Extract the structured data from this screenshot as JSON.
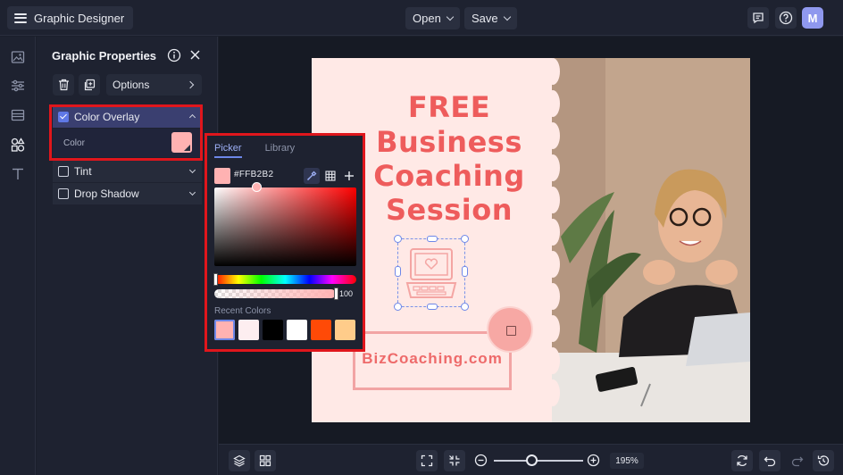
{
  "header": {
    "app_title": "Graphic Designer",
    "open_label": "Open",
    "save_label": "Save",
    "avatar_initial": "M",
    "icons": [
      "menu-icon",
      "feedback-icon",
      "help-icon"
    ]
  },
  "left_rail": {
    "icons": [
      "image-icon",
      "adjustments-icon",
      "layers-icon",
      "graphics-icon",
      "text-icon"
    ]
  },
  "properties_panel": {
    "title": "Graphic Properties",
    "options_label": "Options",
    "sections": [
      {
        "label": "Color Overlay",
        "checked": true,
        "expanded": true
      },
      {
        "label": "Tint",
        "checked": false,
        "expanded": false
      },
      {
        "label": "Drop Shadow",
        "checked": false,
        "expanded": false
      }
    ],
    "color_label": "Color",
    "color_value": "#ffb2b2"
  },
  "color_picker": {
    "tabs": [
      "Picker",
      "Library"
    ],
    "active_tab": "Picker",
    "hex": "#FFB2B2",
    "opacity": "100",
    "recent_label": "Recent Colors",
    "recent_colors": [
      "#ffb2b2",
      "#fdeef0",
      "#000000",
      "#ffffff",
      "#ff4a07",
      "#ffcc8a"
    ]
  },
  "canvas": {
    "headline": [
      "FREE",
      "Business",
      "Coaching",
      "Session"
    ],
    "brand_text": "BizCoaching.com",
    "colors": {
      "background": "#ffe9e6",
      "accent": "#ee5c5c"
    }
  },
  "bottom_bar": {
    "zoom": "195%",
    "icons": [
      "layers-icon",
      "grid-icon",
      "fit-screen-icon",
      "shrink-icon",
      "zoom-out-icon",
      "zoom-in-icon",
      "swap-icon",
      "undo-icon",
      "redo-icon",
      "history-icon"
    ]
  }
}
